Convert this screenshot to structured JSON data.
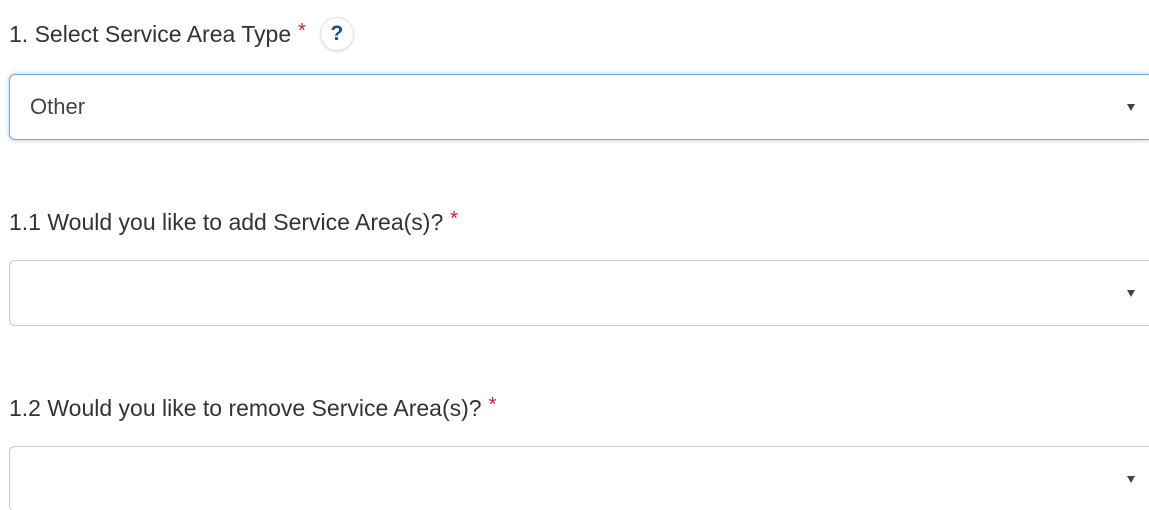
{
  "questions": [
    {
      "label": "1. Select Service Area Type",
      "required_mark": "*",
      "help_label": "?",
      "select_value": "Other"
    },
    {
      "label": "1.1 Would you like to add Service Area(s)?",
      "required_mark": "*",
      "select_value": ""
    },
    {
      "label": "1.2 Would you like to remove Service Area(s)?",
      "required_mark": "*",
      "select_value": ""
    }
  ],
  "colors": {
    "required": "#e31b23",
    "help_icon": "#1f4e8c",
    "focus_border": "#7ea8d6",
    "text": "#333333"
  }
}
